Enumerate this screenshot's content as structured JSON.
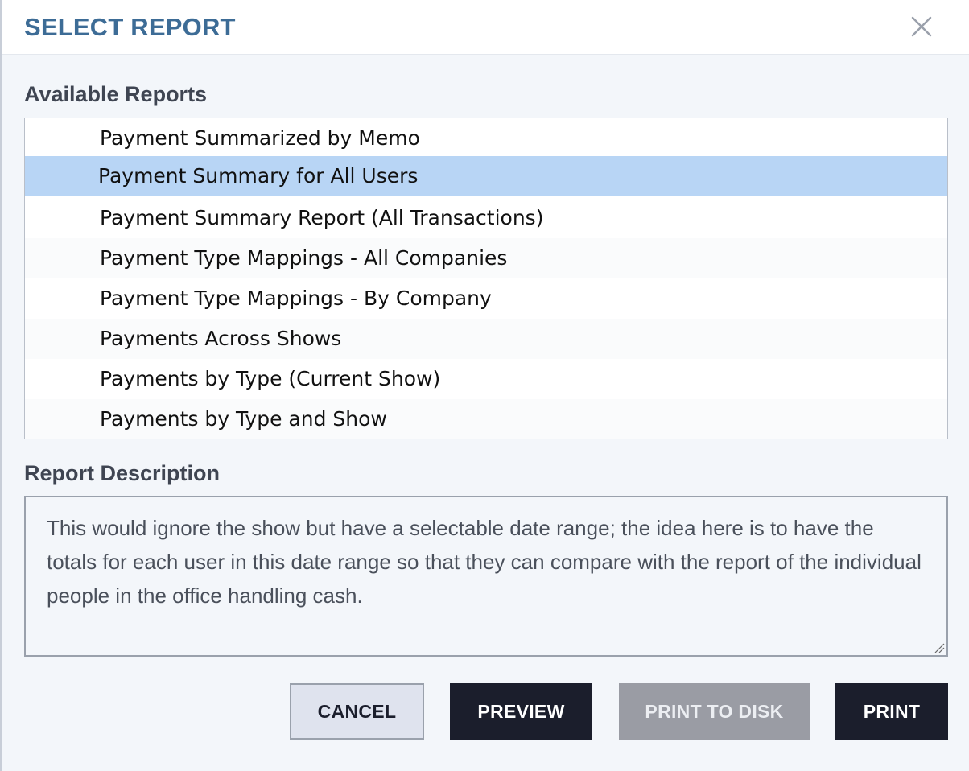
{
  "dialog": {
    "title": "SELECT REPORT",
    "close_icon": "close-icon"
  },
  "reports": {
    "label": "Available Reports",
    "selected_index": 1,
    "items": [
      "Payment Summarized by Memo",
      "Payment Summary for All Users",
      "Payment Summary Report (All Transactions)",
      "Payment Type Mappings - All Companies",
      "Payment Type Mappings - By Company",
      "Payments Across Shows",
      "Payments by Type (Current Show)",
      "Payments by Type and Show"
    ]
  },
  "description": {
    "label": "Report Description",
    "text": "This would ignore the show but have a selectable date range; the idea here is to have the totals for each user in this date range so that they can compare with the report of the individual people in the office handling cash."
  },
  "buttons": {
    "cancel": "CANCEL",
    "preview": "PREVIEW",
    "print_to_disk": "PRINT TO DISK",
    "print": "PRINT"
  },
  "colors": {
    "title": "#3d6c96",
    "selected_row": "#b8d5f5",
    "primary_button": "#1b1e2c",
    "disabled_button": "#9a9ca4"
  }
}
